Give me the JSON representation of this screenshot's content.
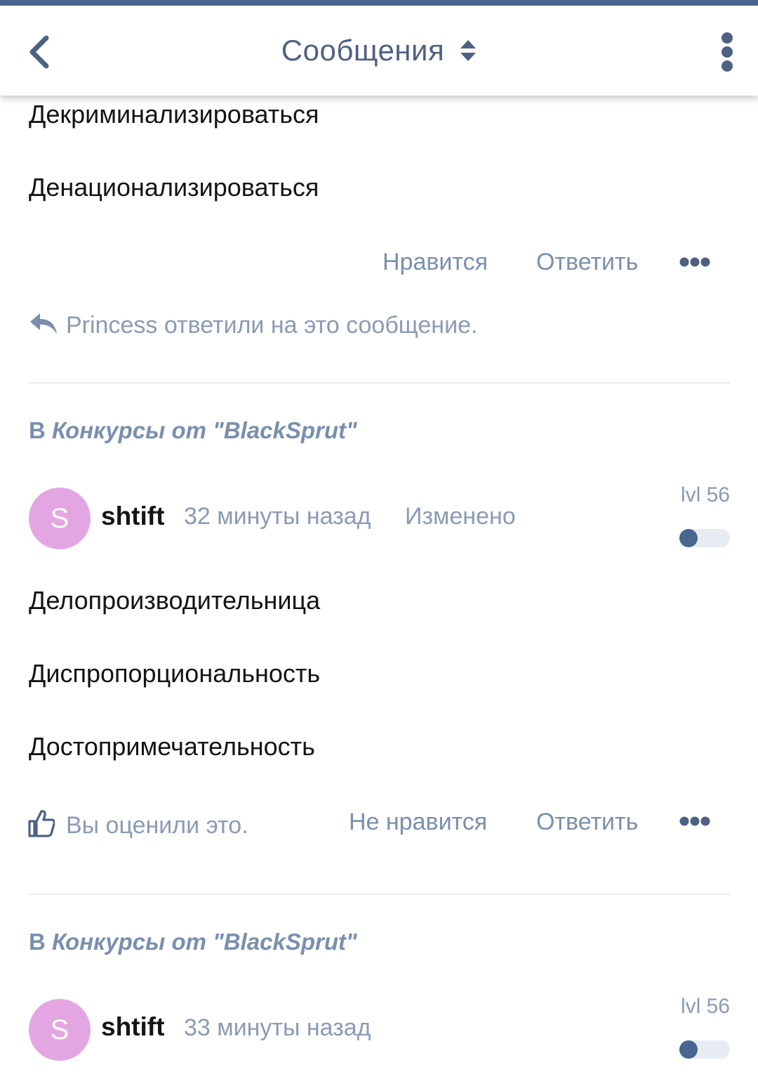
{
  "header": {
    "title": "Сообщения",
    "back_icon": "chevron-left-icon",
    "sort_icon": "sort-updown-icon",
    "menu_icon": "vertical-dots-icon"
  },
  "colors": {
    "accent": "#4a6690",
    "muted_text": "#8a9bb3",
    "avatar_bg": "#e4a6e3",
    "divider": "#e6e9ee"
  },
  "post_top": {
    "lines": [
      "Декриминализироваться",
      "Денационализироваться"
    ],
    "actions": {
      "like": "Нравится",
      "reply": "Ответить",
      "more_icon": "more-horizontal-icon"
    },
    "reply_note": "Princess ответили на это сообщение."
  },
  "posts": [
    {
      "section_prefix": "В",
      "section_name": "Конкурсы от \"BlackSprut\"",
      "avatar_letter": "S",
      "username": "shtift",
      "time": "32 минуты назад",
      "edited": "Изменено",
      "level": "lvl 56",
      "level_fill": 0.3,
      "lines": [
        "Делопроизводительница",
        "Диспропорциональность",
        "Достопримечательность"
      ],
      "rated": "Вы оценили это.",
      "actions": {
        "unlike": "Не нравится",
        "reply": "Ответить"
      }
    },
    {
      "section_prefix": "В",
      "section_name": "Конкурсы от \"BlackSprut\"",
      "avatar_letter": "S",
      "username": "shtift",
      "time": "33 минуты назад",
      "level": "lvl 56",
      "level_fill": 0.3
    }
  ]
}
